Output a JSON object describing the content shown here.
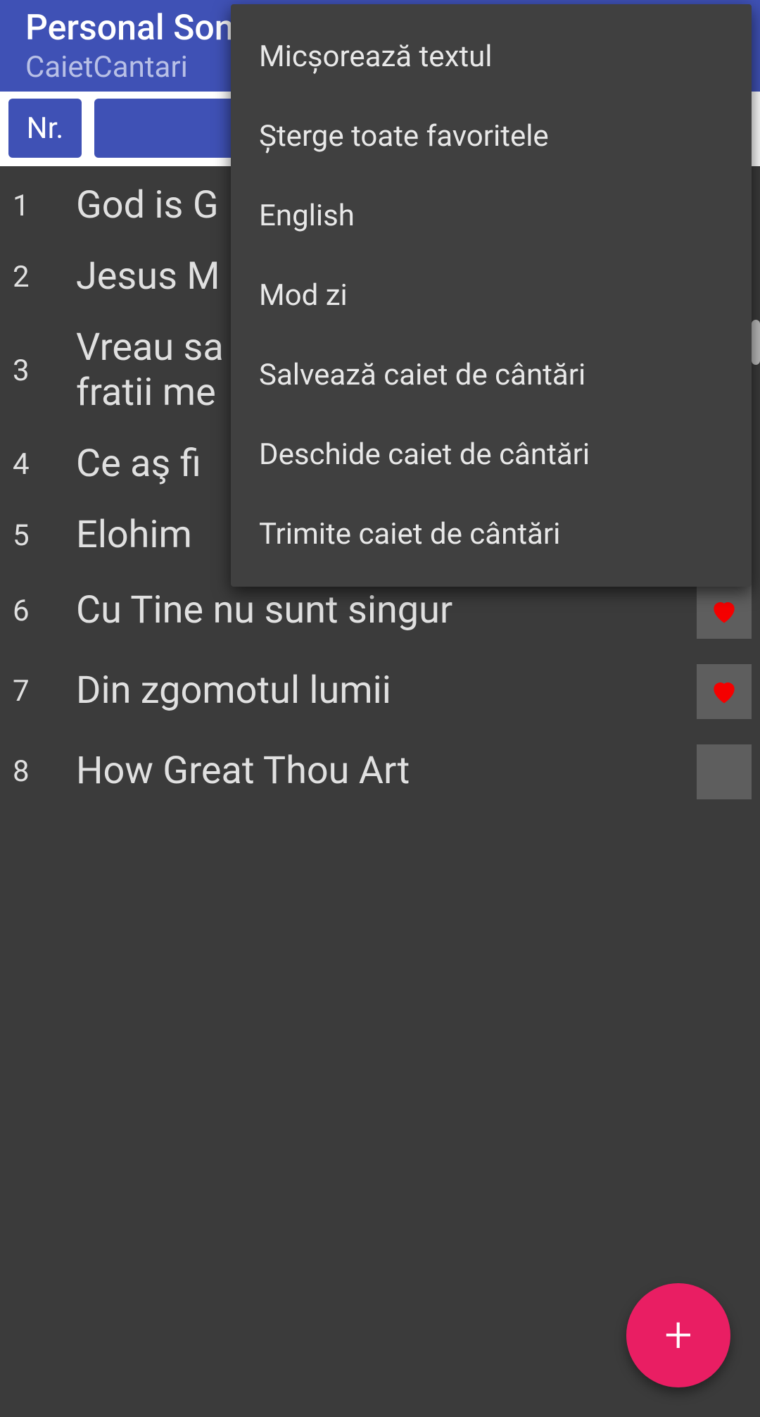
{
  "header": {
    "title": "Personal Songbook",
    "subtitle": "CaietCantari",
    "title_visible": "Personal Song"
  },
  "columns": {
    "nr": "Nr.",
    "title": "",
    "fav": ""
  },
  "songs": [
    {
      "index": "1",
      "title": "God is Good",
      "title_visible": "God is G",
      "favorite": false
    },
    {
      "index": "2",
      "title": "Jesus Messiah",
      "title_visible": "Jesus M",
      "favorite": false
    },
    {
      "index": "3",
      "title": "Vreau sa fiu ca fratii mei",
      "title_visible": "Vreau sa fratii me",
      "favorite": false
    },
    {
      "index": "4",
      "title": "Ce aş fi",
      "title_visible": "Ce aş fi",
      "favorite": false
    },
    {
      "index": "5",
      "title": "Elohim",
      "title_visible": "Elohim",
      "favorite": false
    },
    {
      "index": "6",
      "title": "Cu Tine nu sunt singur",
      "title_visible": "Cu Tine nu sunt singur",
      "favorite": true
    },
    {
      "index": "7",
      "title": "Din zgomotul lumii",
      "title_visible": "Din zgomotul lumii",
      "favorite": true
    },
    {
      "index": "8",
      "title": "How Great Thou Art",
      "title_visible": "How Great Thou Art",
      "favorite": false
    }
  ],
  "menu": {
    "items": [
      "Micșorează textul",
      "Șterge toate favoritele",
      "English",
      "Mod zi",
      "Salvează caiet de cântări",
      "Deschide caiet de cântări",
      "Trimite caiet de cântări"
    ]
  },
  "fab": {
    "label": "+"
  },
  "colors": {
    "primary": "#3f51b5",
    "accent": "#e91e63",
    "background": "#3b3b3b"
  }
}
